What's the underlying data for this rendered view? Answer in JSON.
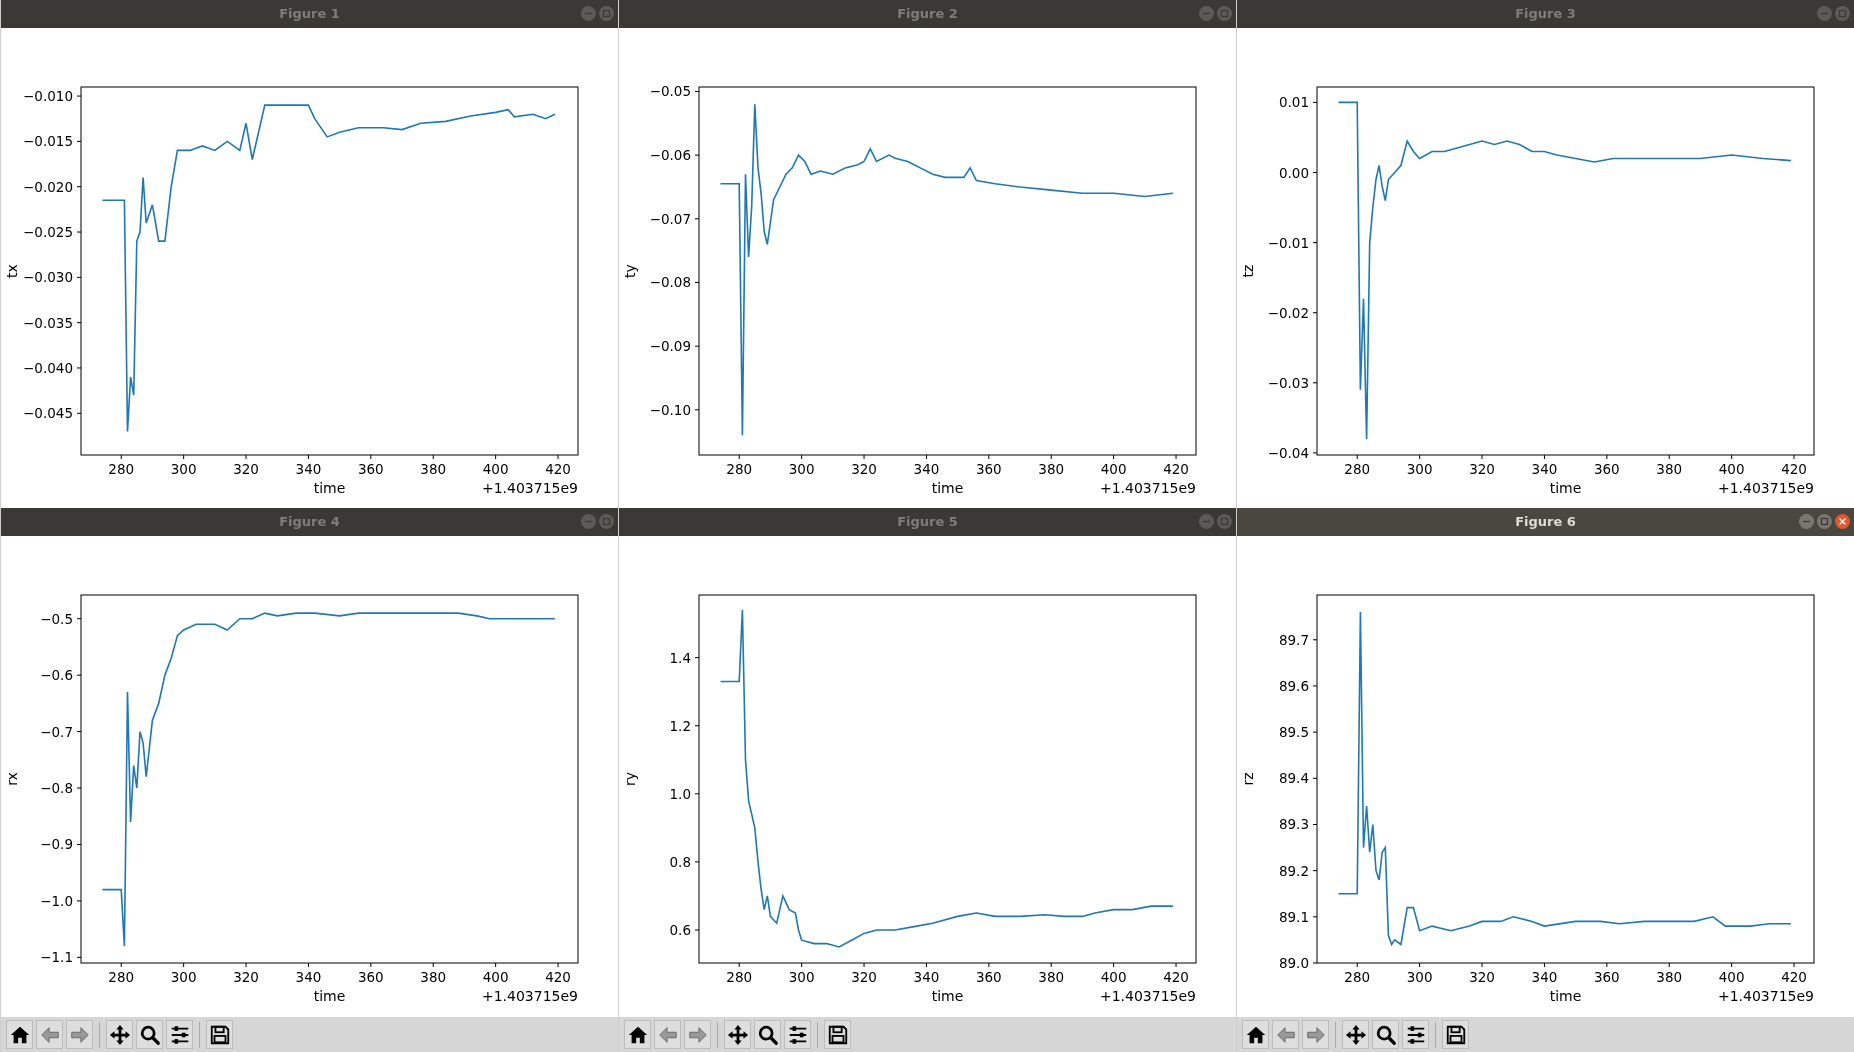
{
  "windows": [
    {
      "title": "Figure 1",
      "active": false,
      "offset_text": "+1.403715e9",
      "chart_data": {
        "type": "line",
        "xlabel": "time",
        "ylabel": "tx",
        "xlim": [
          267.1,
          426.4
        ],
        "ylim": [
          -0.0496,
          -0.009
        ],
        "xticks": [
          280,
          300,
          320,
          340,
          360,
          380,
          400,
          420
        ],
        "yticks": [
          {
            "value": -0.01,
            "label": "−0.010"
          },
          {
            "value": -0.015,
            "label": "−0.015"
          },
          {
            "value": -0.02,
            "label": "−0.020"
          },
          {
            "value": -0.025,
            "label": "−0.025"
          },
          {
            "value": -0.03,
            "label": "−0.030"
          },
          {
            "value": -0.035,
            "label": "−0.035"
          },
          {
            "value": -0.04,
            "label": "−0.040"
          },
          {
            "value": -0.045,
            "label": "−0.045"
          }
        ],
        "x": [
          274,
          281,
          282,
          283,
          284,
          285,
          286,
          287,
          288,
          290,
          292,
          294,
          296,
          298,
          302,
          306,
          310,
          314,
          318,
          320,
          322,
          326,
          332,
          340,
          342,
          346,
          350,
          356,
          364,
          370,
          376,
          384,
          392,
          400,
          404,
          406,
          412,
          416,
          419
        ],
        "series": [
          {
            "color": "#1f77b4",
            "values": [
              -0.0215,
              -0.0215,
              -0.047,
              -0.041,
              -0.043,
              -0.026,
              -0.025,
              -0.019,
              -0.024,
              -0.022,
              -0.026,
              -0.026,
              -0.02,
              -0.016,
              -0.016,
              -0.0155,
              -0.016,
              -0.015,
              -0.016,
              -0.013,
              -0.017,
              -0.011,
              -0.011,
              -0.011,
              -0.0125,
              -0.0145,
              -0.014,
              -0.0135,
              -0.0135,
              -0.0137,
              -0.013,
              -0.0128,
              -0.0122,
              -0.0118,
              -0.0115,
              -0.0123,
              -0.012,
              -0.0125,
              -0.012
            ]
          }
        ]
      }
    },
    {
      "title": "Figure 2",
      "active": false,
      "offset_text": "+1.403715e9",
      "chart_data": {
        "type": "line",
        "xlabel": "time",
        "ylabel": "ty",
        "xlim": [
          267.1,
          426.4
        ],
        "ylim": [
          -0.1071,
          -0.0493
        ],
        "xticks": [
          280,
          300,
          320,
          340,
          360,
          380,
          400,
          420
        ],
        "yticks": [
          {
            "value": -0.05,
            "label": "−0.05"
          },
          {
            "value": -0.06,
            "label": "−0.06"
          },
          {
            "value": -0.07,
            "label": "−0.07"
          },
          {
            "value": -0.08,
            "label": "−0.08"
          },
          {
            "value": -0.09,
            "label": "−0.09"
          },
          {
            "value": -0.1,
            "label": "−0.10"
          }
        ],
        "x": [
          274,
          280,
          281,
          282,
          283,
          284,
          285,
          286,
          287,
          288,
          289,
          291,
          293,
          295,
          297,
          299,
          301,
          303,
          306,
          310,
          314,
          318,
          320,
          322,
          324,
          328,
          330,
          334,
          338,
          342,
          346,
          352,
          354,
          356,
          362,
          370,
          380,
          390,
          400,
          410,
          419
        ],
        "series": [
          {
            "color": "#1f77b4",
            "values": [
              -0.0645,
              -0.0645,
              -0.104,
              -0.063,
              -0.076,
              -0.068,
              -0.052,
              -0.062,
              -0.066,
              -0.072,
              -0.074,
              -0.067,
              -0.065,
              -0.063,
              -0.062,
              -0.06,
              -0.061,
              -0.063,
              -0.0625,
              -0.063,
              -0.062,
              -0.0615,
              -0.061,
              -0.059,
              -0.061,
              -0.06,
              -0.0605,
              -0.061,
              -0.062,
              -0.063,
              -0.0635,
              -0.0635,
              -0.062,
              -0.064,
              -0.0645,
              -0.065,
              -0.0655,
              -0.066,
              -0.066,
              -0.0665,
              -0.066
            ]
          }
        ]
      }
    },
    {
      "title": "Figure 3",
      "active": false,
      "offset_text": "+1.403715e9",
      "chart_data": {
        "type": "line",
        "xlabel": "time",
        "ylabel": "tz",
        "xlim": [
          267.1,
          426.4
        ],
        "ylim": [
          -0.0403,
          0.0122
        ],
        "xticks": [
          280,
          300,
          320,
          340,
          360,
          380,
          400,
          420
        ],
        "yticks": [
          {
            "value": 0.01,
            "label": "0.01"
          },
          {
            "value": 0,
            "label": "0.00"
          },
          {
            "value": -0.01,
            "label": "−0.01"
          },
          {
            "value": -0.02,
            "label": "−0.02"
          },
          {
            "value": -0.03,
            "label": "−0.03"
          },
          {
            "value": -0.04,
            "label": "−0.04"
          }
        ],
        "x": [
          274,
          280,
          281,
          282,
          283,
          284,
          285,
          286,
          287,
          288,
          289,
          290,
          292,
          294,
          296,
          298,
          300,
          304,
          308,
          312,
          316,
          320,
          324,
          328,
          332,
          336,
          340,
          344,
          350,
          356,
          362,
          370,
          380,
          390,
          400,
          410,
          419
        ],
        "series": [
          {
            "color": "#1f77b4",
            "values": [
              0.01,
              0.01,
              -0.031,
              -0.018,
              -0.038,
              -0.01,
              -0.005,
              -0.001,
              0.001,
              -0.002,
              -0.004,
              -0.001,
              0,
              0.001,
              0.0045,
              0.003,
              0.002,
              0.003,
              0.003,
              0.0035,
              0.004,
              0.0045,
              0.004,
              0.0045,
              0.004,
              0.003,
              0.003,
              0.0025,
              0.002,
              0.0015,
              0.002,
              0.002,
              0.002,
              0.002,
              0.0025,
              0.002,
              0.0017
            ]
          }
        ]
      }
    },
    {
      "title": "Figure 4",
      "active": false,
      "offset_text": "+1.403715e9",
      "chart_data": {
        "type": "line",
        "xlabel": "time",
        "ylabel": "rx",
        "xlim": [
          267.1,
          426.4
        ],
        "ylim": [
          -1.11,
          -0.458
        ],
        "xticks": [
          280,
          300,
          320,
          340,
          360,
          380,
          400,
          420
        ],
        "yticks": [
          {
            "value": -0.5,
            "label": "−0.5"
          },
          {
            "value": -0.6,
            "label": "−0.6"
          },
          {
            "value": -0.7,
            "label": "−0.7"
          },
          {
            "value": -0.8,
            "label": "−0.8"
          },
          {
            "value": -0.9,
            "label": "−0.9"
          },
          {
            "value": -1.0,
            "label": "−1.0"
          },
          {
            "value": -1.1,
            "label": "−1.1"
          }
        ],
        "x": [
          274,
          280,
          281,
          282,
          283,
          284,
          285,
          286,
          287,
          288,
          290,
          292,
          294,
          296,
          298,
          300,
          304,
          310,
          314,
          318,
          322,
          326,
          330,
          336,
          342,
          350,
          356,
          362,
          370,
          380,
          388,
          394,
          398,
          406,
          412,
          419
        ],
        "series": [
          {
            "color": "#1f77b4",
            "values": [
              -0.98,
              -0.98,
              -1.08,
              -0.63,
              -0.86,
              -0.76,
              -0.8,
              -0.7,
              -0.72,
              -0.78,
              -0.68,
              -0.65,
              -0.6,
              -0.57,
              -0.53,
              -0.52,
              -0.51,
              -0.51,
              -0.52,
              -0.5,
              -0.5,
              -0.49,
              -0.495,
              -0.49,
              -0.49,
              -0.495,
              -0.49,
              -0.49,
              -0.49,
              -0.49,
              -0.49,
              -0.495,
              -0.5,
              -0.5,
              -0.5,
              -0.5
            ]
          }
        ]
      }
    },
    {
      "title": "Figure 5",
      "active": false,
      "offset_text": "+1.403715e9",
      "chart_data": {
        "type": "line",
        "xlabel": "time",
        "ylabel": "ry",
        "xlim": [
          267.1,
          426.4
        ],
        "ylim": [
          0.503,
          1.584
        ],
        "xticks": [
          280,
          300,
          320,
          340,
          360,
          380,
          400,
          420
        ],
        "yticks": [
          {
            "value": 1.4,
            "label": "1.4"
          },
          {
            "value": 1.2,
            "label": "1.2"
          },
          {
            "value": 1.0,
            "label": "1.0"
          },
          {
            "value": 0.8,
            "label": "0.8"
          },
          {
            "value": 0.6,
            "label": "0.6"
          }
        ],
        "x": [
          274,
          280,
          281,
          282,
          283,
          285,
          286,
          287,
          288,
          289,
          290,
          292,
          294,
          296,
          298,
          299,
          300,
          304,
          308,
          312,
          316,
          320,
          324,
          330,
          336,
          342,
          350,
          356,
          362,
          370,
          378,
          384,
          390,
          394,
          400,
          406,
          412,
          419
        ],
        "series": [
          {
            "color": "#1f77b4",
            "values": [
              1.33,
              1.33,
              1.54,
              1.1,
              0.98,
              0.9,
              0.8,
              0.72,
              0.66,
              0.7,
              0.64,
              0.62,
              0.7,
              0.66,
              0.65,
              0.6,
              0.57,
              0.56,
              0.56,
              0.55,
              0.57,
              0.59,
              0.6,
              0.6,
              0.61,
              0.62,
              0.64,
              0.65,
              0.64,
              0.64,
              0.645,
              0.64,
              0.64,
              0.65,
              0.66,
              0.66,
              0.67,
              0.67
            ]
          }
        ]
      }
    },
    {
      "title": "Figure 6",
      "active": true,
      "offset_text": "+1.403715e9",
      "chart_data": {
        "type": "line",
        "xlabel": "time",
        "ylabel": "rz",
        "xlim": [
          267.1,
          426.4
        ],
        "ylim": [
          89.0,
          89.797
        ],
        "xticks": [
          280,
          300,
          320,
          340,
          360,
          380,
          400,
          420
        ],
        "yticks": [
          {
            "value": 89.7,
            "label": "89.7"
          },
          {
            "value": 89.6,
            "label": "89.6"
          },
          {
            "value": 89.5,
            "label": "89.5"
          },
          {
            "value": 89.4,
            "label": "89.4"
          },
          {
            "value": 89.3,
            "label": "89.3"
          },
          {
            "value": 89.2,
            "label": "89.2"
          },
          {
            "value": 89.1,
            "label": "89.1"
          },
          {
            "value": 89.0,
            "label": "89.0"
          }
        ],
        "x": [
          274,
          280,
          281,
          282,
          283,
          284,
          285,
          286,
          287,
          288,
          289,
          290,
          291,
          292,
          294,
          296,
          298,
          300,
          304,
          310,
          316,
          320,
          326,
          330,
          336,
          340,
          350,
          358,
          364,
          372,
          380,
          388,
          394,
          398,
          406,
          412,
          419
        ],
        "series": [
          {
            "color": "#1f77b4",
            "values": [
              89.15,
              89.15,
              89.76,
              89.25,
              89.34,
              89.24,
              89.3,
              89.2,
              89.18,
              89.24,
              89.25,
              89.06,
              89.04,
              89.05,
              89.04,
              89.12,
              89.12,
              89.07,
              89.08,
              89.07,
              89.08,
              89.09,
              89.09,
              89.1,
              89.09,
              89.08,
              89.09,
              89.09,
              89.085,
              89.09,
              89.09,
              89.09,
              89.1,
              89.08,
              89.08,
              89.085,
              89.085
            ]
          }
        ]
      }
    }
  ]
}
